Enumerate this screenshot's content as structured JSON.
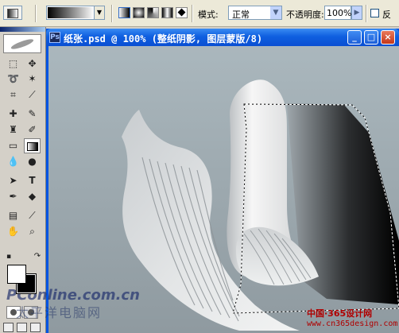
{
  "options_bar": {
    "mode_label": "模式:",
    "mode_value": "正常",
    "opacity_label": "不透明度:",
    "opacity_value": "100%",
    "reverse_label": "反",
    "gradient_types": [
      "linear",
      "radial",
      "angle",
      "reflected",
      "diamond"
    ],
    "dropdown_icon": "chevron-down-icon"
  },
  "toolbox": {
    "tools": [
      "marquee",
      "move",
      "lasso",
      "magic-wand",
      "crop",
      "slice",
      "healing-brush",
      "brush",
      "clone-stamp",
      "history-brush",
      "eraser",
      "gradient",
      "blur",
      "dodge",
      "path-selection",
      "type",
      "pen",
      "shape",
      "notes",
      "eyedropper",
      "hand",
      "zoom"
    ],
    "active_tool": "gradient",
    "foreground_color": "#ffffff",
    "background_color": "#000000"
  },
  "document": {
    "title": "纸张.psd @ 100% (整纸阴影, 图层蒙版/8)",
    "minimize_glyph": "_",
    "maximize_glyph": "□",
    "close_glyph": "×"
  },
  "watermarks": {
    "pconline": "PConline.com.cn",
    "pconline_cn": "太平洋电脑网",
    "site_title": "中国·365设计网",
    "site_url": "www.cn365design.com"
  },
  "colors": {
    "titlebar": "#0a4fd2",
    "canvas_bg": "#9aa5ab",
    "watermark_red": "#b00000"
  }
}
